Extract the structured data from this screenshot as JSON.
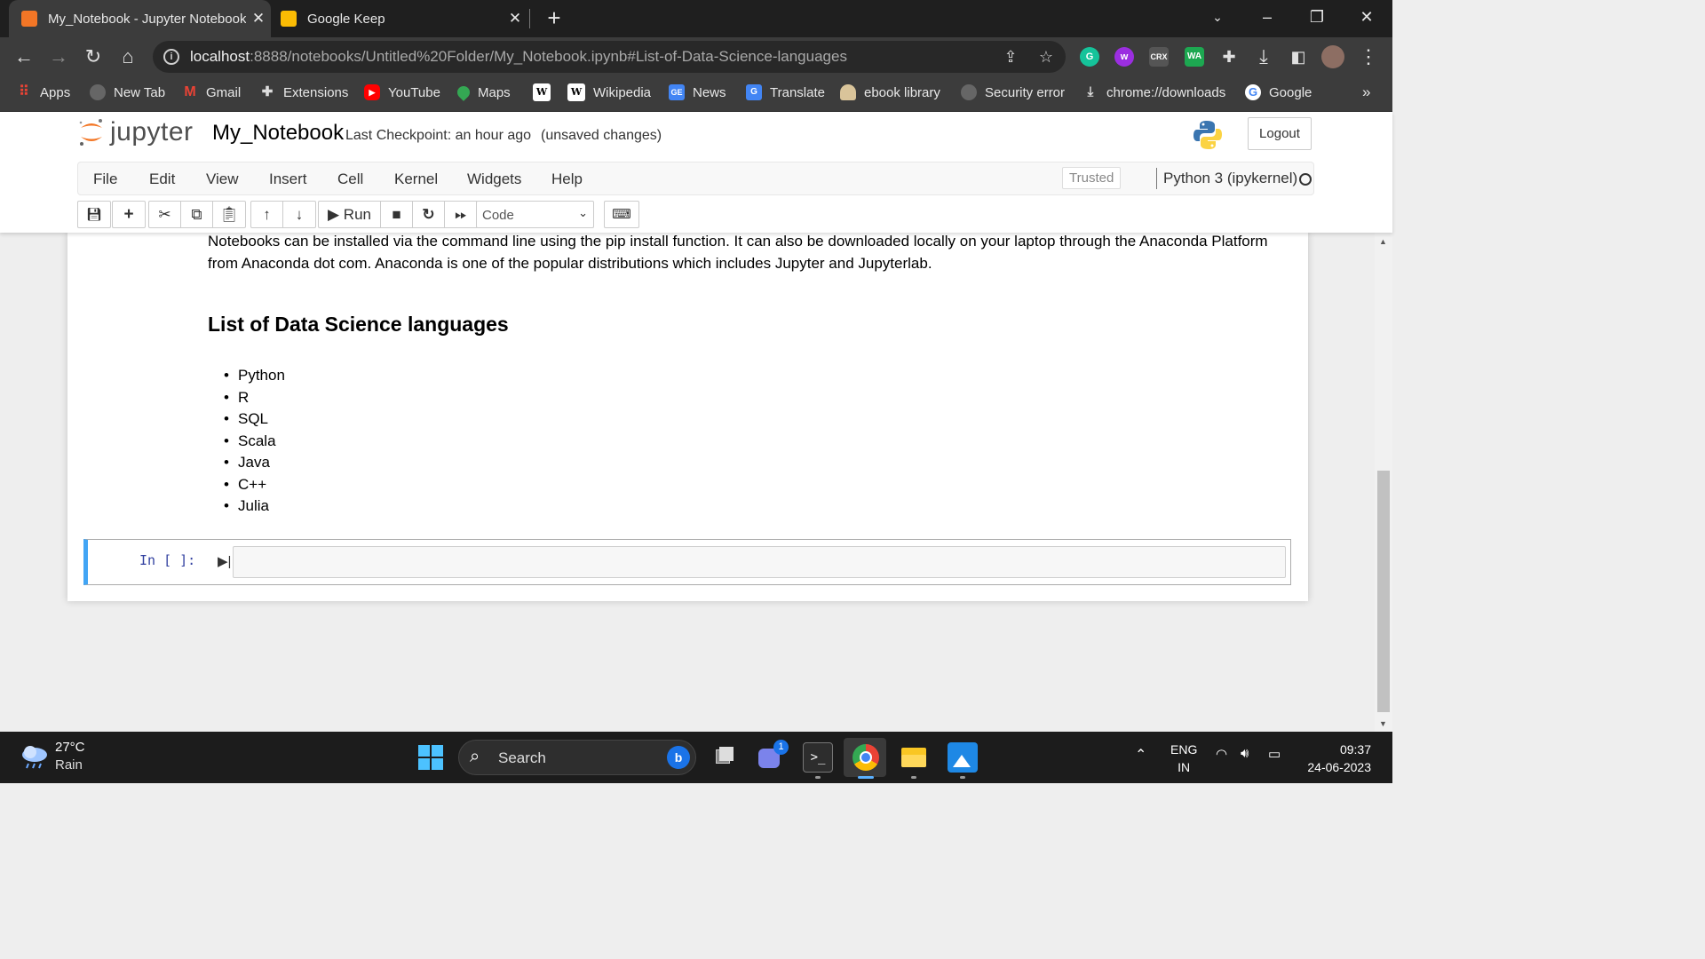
{
  "browser": {
    "tabs": [
      {
        "title": "My_Notebook - Jupyter Notebook",
        "favicon": "jupyter-book-icon",
        "active": true
      },
      {
        "title": "Google Keep",
        "favicon": "google-keep-icon",
        "active": false
      }
    ],
    "url_host": "localhost",
    "url_rest": ":8888/notebooks/Untitled%20Folder/My_Notebook.ipynb#List-of-Data-Science-languages",
    "extensions": [
      {
        "name": "grammarly-icon",
        "label": "G",
        "color": "#15c39a"
      },
      {
        "name": "wikiwand-icon",
        "label": "w",
        "color": "#9b2ee0"
      },
      {
        "name": "crx-icon",
        "label": "CRX",
        "color": "#555555"
      },
      {
        "name": "whatsapp-icon",
        "label": "WA",
        "color": "#1da851"
      }
    ],
    "bookmarks": [
      {
        "label": "Apps",
        "icon": "apps-grid-icon"
      },
      {
        "label": "New Tab",
        "icon": "globe-icon"
      },
      {
        "label": "Gmail",
        "icon": "gmail-icon"
      },
      {
        "label": "Extensions",
        "icon": "puzzle-icon"
      },
      {
        "label": "YouTube",
        "icon": "youtube-icon"
      },
      {
        "label": "Maps",
        "icon": "maps-pin-icon"
      },
      {
        "label": "",
        "icon": "wikipedia-w-icon"
      },
      {
        "label": "Wikipedia",
        "icon": "wikipedia-icon"
      },
      {
        "label": "News",
        "icon": "google-news-icon"
      },
      {
        "label": "Translate",
        "icon": "google-translate-icon"
      },
      {
        "label": "ebook library",
        "icon": "ebook-icon"
      },
      {
        "label": "Security error",
        "icon": "globe-icon"
      },
      {
        "label": "chrome://downloads",
        "icon": "download-icon"
      },
      {
        "label": "Google",
        "icon": "google-g-icon"
      }
    ],
    "more_bookmarks": "»"
  },
  "jupyter": {
    "logo_text": "jupyter",
    "notebook_name": "My_Notebook",
    "checkpoint": "Last Checkpoint: an hour ago",
    "unsaved": "(unsaved changes)",
    "logout": "Logout",
    "menus": [
      "File",
      "Edit",
      "View",
      "Insert",
      "Cell",
      "Kernel",
      "Widgets",
      "Help"
    ],
    "trusted": "Trusted",
    "kernel": "Python 3 (ipykernel)",
    "toolbar": {
      "run_label": "Run",
      "cell_type": "Code"
    }
  },
  "notebook": {
    "paragraph": "Notebooks can be installed via the command line using the pip install function. It can also be downloaded locally on your laptop through the Anaconda Platform from Anaconda dot com. Anaconda is one of the popular distributions which includes Jupyter and Jupyterlab.",
    "heading": "List of Data Science languages",
    "languages": [
      "Python",
      "R",
      "SQL",
      "Scala",
      "Java",
      "C++",
      "Julia"
    ],
    "code_prompt": "In [ ]:"
  },
  "taskbar": {
    "temperature": "27°C",
    "condition": "Rain",
    "search_label": "Search",
    "teams_badge": "1",
    "lang_top": "ENG",
    "lang_bottom": "IN",
    "time": "09:37",
    "date": "24-06-2023"
  }
}
